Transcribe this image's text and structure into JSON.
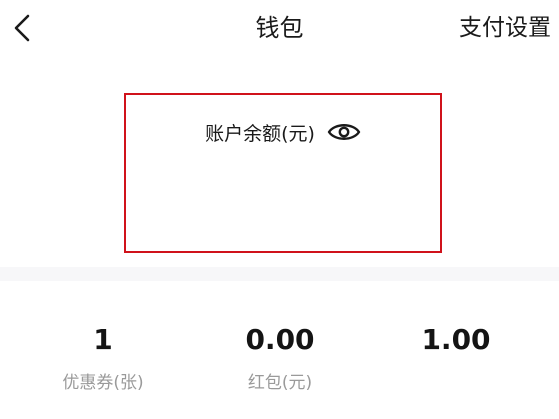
{
  "nav": {
    "back_icon": "chevron-left-icon",
    "title": "钱包",
    "action_label": "支付设置"
  },
  "balance": {
    "label": "账户余额(元)",
    "visibility_icon": "eye-icon",
    "highlight_color": "#d0121b"
  },
  "stats": [
    {
      "value": "1",
      "label": "优惠券(张)"
    },
    {
      "value": "0.00",
      "label": "红包(元)"
    },
    {
      "value": "1.00",
      "label": ""
    }
  ]
}
